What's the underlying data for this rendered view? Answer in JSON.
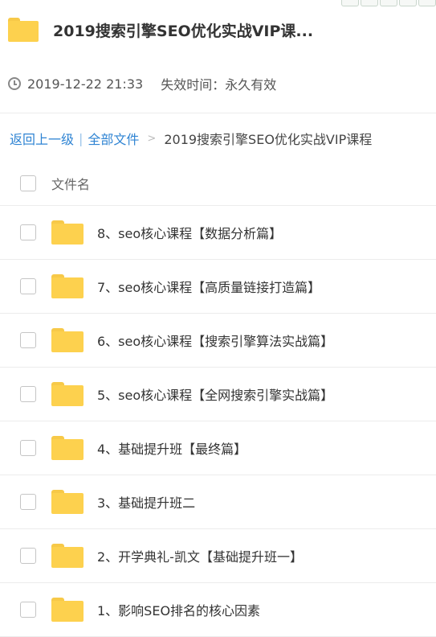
{
  "header": {
    "title": "2019搜索引擎SEO优化实战VIP课...",
    "date": "2019-12-22 21:33",
    "expire": "失效时间：永久有效"
  },
  "breadcrumb": {
    "back": "返回上一级",
    "separator": "|",
    "all_files": "全部文件",
    "arrow": ">",
    "current": "2019搜索引擎SEO优化实战VIP课程"
  },
  "list": {
    "column_header": "文件名",
    "items": [
      {
        "name": "8、seo核心课程【数据分析篇】"
      },
      {
        "name": "7、seo核心课程【高质量链接打造篇】"
      },
      {
        "name": "6、seo核心课程【搜索引擎算法实战篇】"
      },
      {
        "name": "5、seo核心课程【全网搜索引擎实战篇】"
      },
      {
        "name": "4、基础提升班【最终篇】"
      },
      {
        "name": "3、基础提升班二"
      },
      {
        "name": "2、开学典礼-凯文【基础提升班一】"
      },
      {
        "name": "1、影响SEO排名的核心因素"
      }
    ]
  },
  "colors": {
    "folder": "#fdd14e",
    "link": "#2f84d3"
  }
}
